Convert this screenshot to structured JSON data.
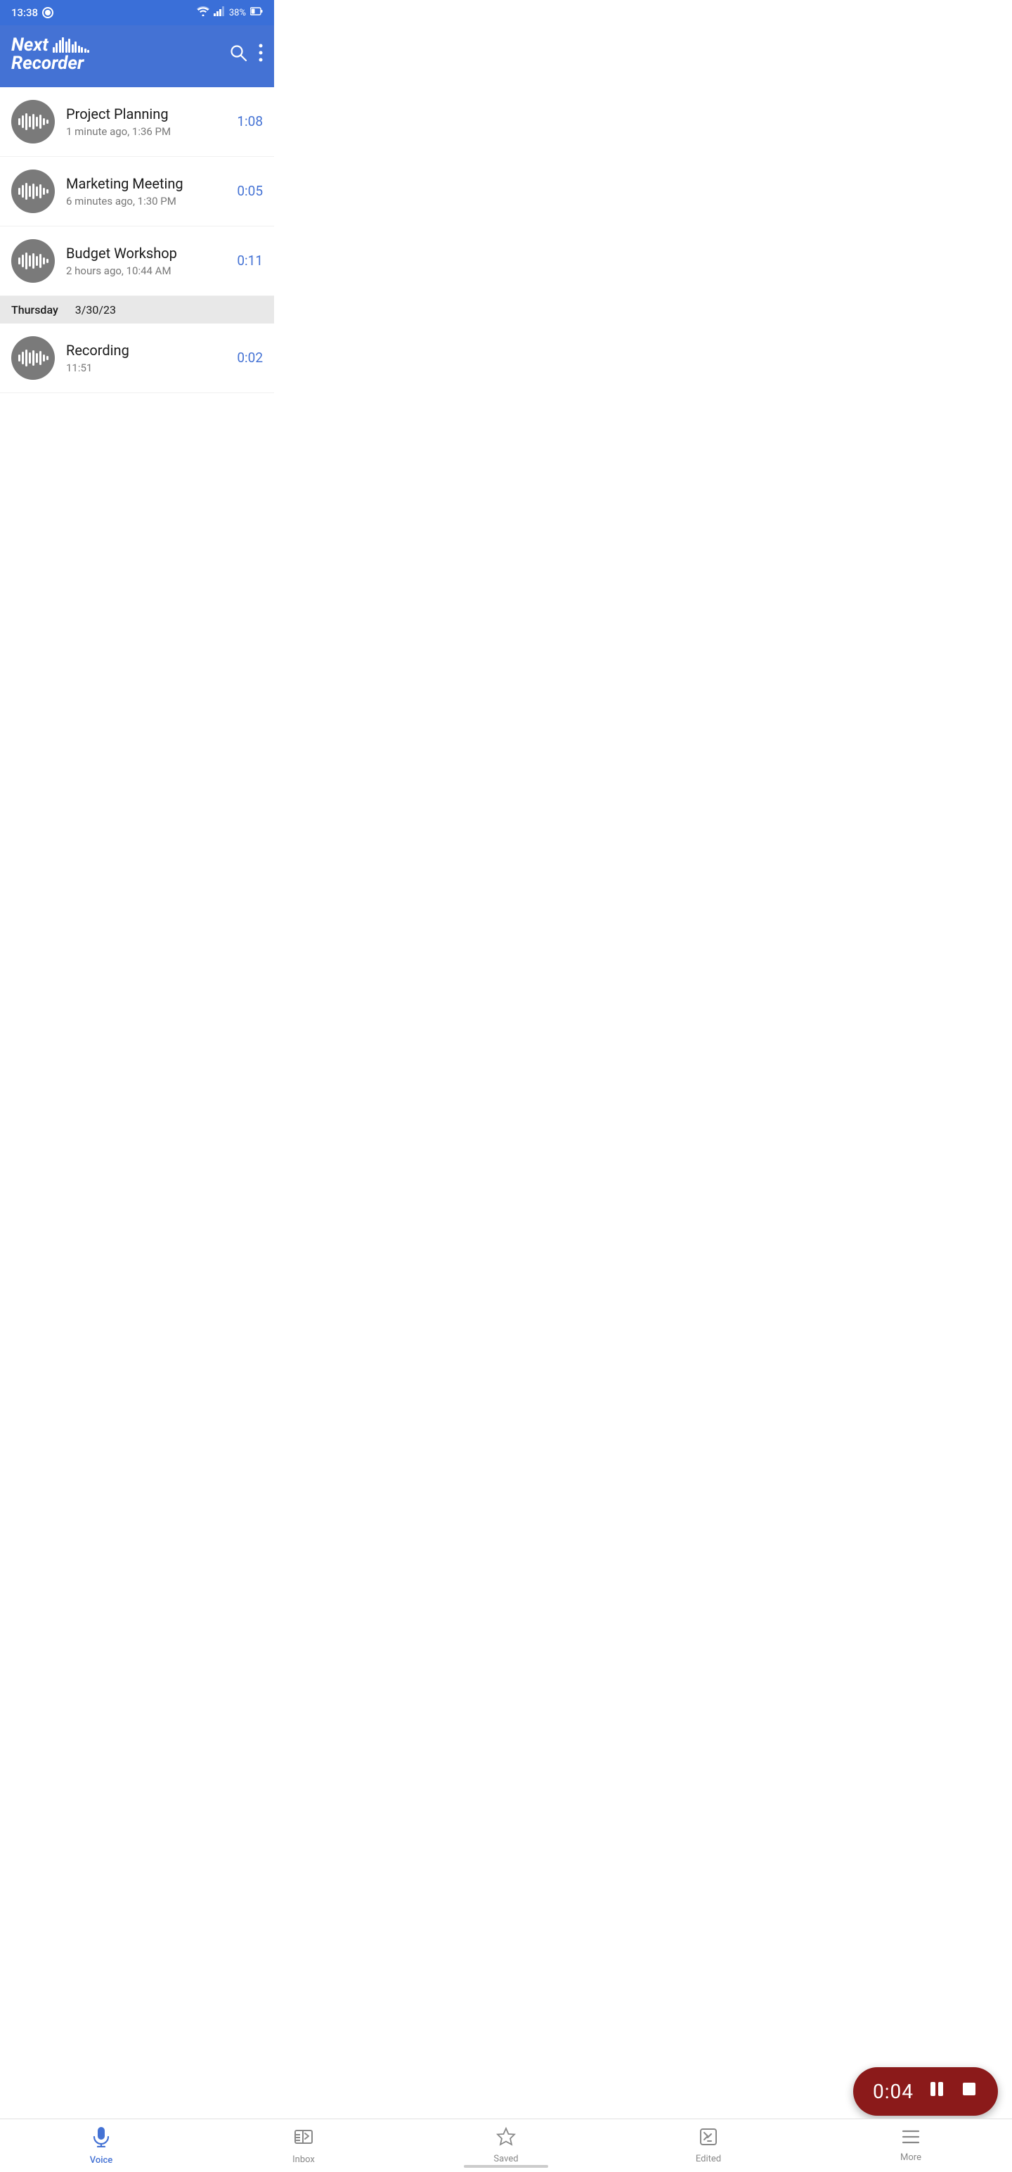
{
  "statusBar": {
    "time": "13:38",
    "battery": "38%"
  },
  "header": {
    "appName1": "Next",
    "appName2": "Recorder",
    "searchLabel": "search",
    "moreLabel": "more options"
  },
  "recordings": [
    {
      "title": "Project Planning",
      "meta": "1 minute ago, 1:36 PM",
      "duration": "1:08"
    },
    {
      "title": "Marketing Meeting",
      "meta": "6 minutes ago, 1:30 PM",
      "duration": "0:05"
    },
    {
      "title": "Budget Workshop",
      "meta": "2 hours ago, 10:44 AM",
      "duration": "0:11"
    }
  ],
  "dateSeparator": {
    "day": "Thursday",
    "date": "3/30/23"
  },
  "recordingThursday": {
    "title": "Recording",
    "meta": "11:51",
    "duration": "0:02"
  },
  "recordingControl": {
    "timer": "0:04",
    "pauseLabel": "pause",
    "stopLabel": "stop"
  },
  "bottomNav": [
    {
      "id": "voice",
      "label": "Voice",
      "active": true
    },
    {
      "id": "inbox",
      "label": "Inbox",
      "active": false
    },
    {
      "id": "saved",
      "label": "Saved",
      "active": false
    },
    {
      "id": "edited",
      "label": "Edited",
      "active": false
    },
    {
      "id": "more",
      "label": "More",
      "active": false
    }
  ]
}
